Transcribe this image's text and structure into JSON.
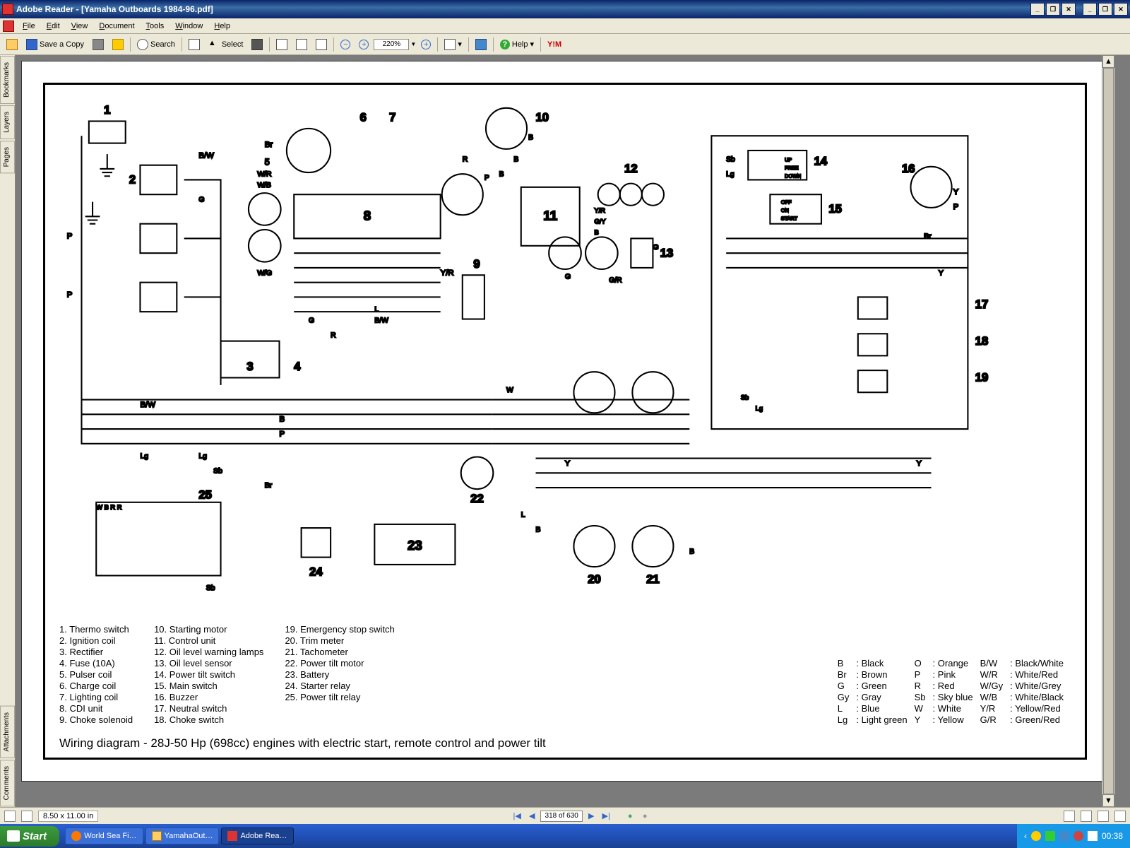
{
  "window": {
    "title": "Adobe Reader - [Yamaha Outboards 1984-96.pdf]",
    "min": "_",
    "max": "❐",
    "restore": "❐",
    "close": "✕"
  },
  "menu": {
    "file": "File",
    "edit": "Edit",
    "view": "View",
    "document": "Document",
    "tools": "Tools",
    "window": "Window",
    "help": "Help"
  },
  "toolbar": {
    "save": "Save a Copy",
    "search": "Search",
    "select": "Select",
    "zoom_value": "220%",
    "help": "Help",
    "ym": "Y!M"
  },
  "sidetabs": {
    "bookmarks": "Bookmarks",
    "layers": "Layers",
    "pages": "Pages",
    "attachments": "Attachments",
    "comments": "Comments"
  },
  "status": {
    "page_size": "8.50 x 11.00 in",
    "page_current": "318",
    "page_field": "318 of 630"
  },
  "taskbar": {
    "start": "Start",
    "tasks": [
      "World Sea Fi…",
      "YamahaOut…",
      "Adobe Rea…"
    ],
    "clock": "00:38"
  },
  "diagram": {
    "title": "Wiring diagram - 28J-50 Hp (698cc) engines with electric start, remote control and power tilt",
    "components": [
      {
        "n": "1",
        "t": "Thermo switch"
      },
      {
        "n": "2",
        "t": "Ignition coil"
      },
      {
        "n": "3",
        "t": "Rectifier"
      },
      {
        "n": "4",
        "t": "Fuse (10A)"
      },
      {
        "n": "5",
        "t": "Pulser coil"
      },
      {
        "n": "6",
        "t": "Charge coil"
      },
      {
        "n": "7",
        "t": "Lighting coil"
      },
      {
        "n": "8",
        "t": "CDI unit"
      },
      {
        "n": "9",
        "t": "Choke solenoid"
      },
      {
        "n": "10",
        "t": "Starting motor"
      },
      {
        "n": "11",
        "t": "Control unit"
      },
      {
        "n": "12",
        "t": "Oil level warning lamps"
      },
      {
        "n": "13",
        "t": "Oil level sensor"
      },
      {
        "n": "14",
        "t": "Power tilt switch"
      },
      {
        "n": "15",
        "t": "Main switch"
      },
      {
        "n": "16",
        "t": "Buzzer"
      },
      {
        "n": "17",
        "t": "Neutral switch"
      },
      {
        "n": "18",
        "t": "Choke switch"
      },
      {
        "n": "19",
        "t": "Emergency stop switch"
      },
      {
        "n": "20",
        "t": "Trim meter"
      },
      {
        "n": "21",
        "t": "Tachometer"
      },
      {
        "n": "22",
        "t": "Power tilt motor"
      },
      {
        "n": "23",
        "t": "Battery"
      },
      {
        "n": "24",
        "t": "Starter relay"
      },
      {
        "n": "25",
        "t": "Power tilt relay"
      }
    ],
    "colors": [
      {
        "c": "B",
        "t": "Black"
      },
      {
        "c": "O",
        "t": "Orange"
      },
      {
        "c": "B/W",
        "t": "Black/White"
      },
      {
        "c": "Br",
        "t": "Brown"
      },
      {
        "c": "P",
        "t": "Pink"
      },
      {
        "c": "W/R",
        "t": "White/Red"
      },
      {
        "c": "G",
        "t": "Green"
      },
      {
        "c": "R",
        "t": "Red"
      },
      {
        "c": "W/Gy",
        "t": "White/Grey"
      },
      {
        "c": "Gy",
        "t": "Gray"
      },
      {
        "c": "Sb",
        "t": "Sky blue"
      },
      {
        "c": "W/B",
        "t": "White/Black"
      },
      {
        "c": "L",
        "t": "Blue"
      },
      {
        "c": "W",
        "t": "White"
      },
      {
        "c": "Y/R",
        "t": "Yellow/Red"
      },
      {
        "c": "Lg",
        "t": "Light green"
      },
      {
        "c": "Y",
        "t": "Yellow"
      },
      {
        "c": "G/R",
        "t": "Green/Red"
      }
    ],
    "wire_labels": [
      "Br",
      "W/R",
      "W/B",
      "W/G",
      "B/W",
      "G",
      "P",
      "L",
      "R",
      "B",
      "Y/R",
      "Y",
      "Sb",
      "Lg",
      "O",
      "G/R",
      "G/Y"
    ],
    "switch_labels": {
      "up": "UP",
      "free": "FREE",
      "down": "DOWN",
      "off": "OFF",
      "on": "ON",
      "start": "START"
    }
  }
}
